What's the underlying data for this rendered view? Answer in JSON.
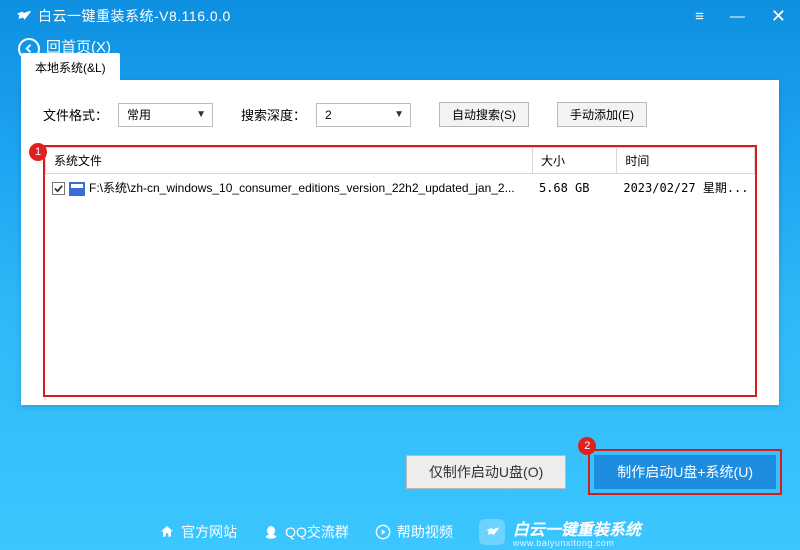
{
  "titlebar": {
    "app_title": "白云一键重装系统-V8.116.0.0"
  },
  "back": {
    "label": "回首页(X)"
  },
  "tab": {
    "local_system": "本地系统(&L)"
  },
  "filters": {
    "format_label": "文件格式：",
    "format_value": "常用",
    "depth_label": "搜索深度：",
    "depth_value": "2",
    "auto_search": "自动搜索(S)",
    "manual_add": "手动添加(E)"
  },
  "table": {
    "col_file": "系统文件",
    "col_size": "大小",
    "col_time": "时间",
    "rows": [
      {
        "checked": true,
        "path": "F:\\系统\\zh-cn_windows_10_consumer_editions_version_22h2_updated_jan_2...",
        "size": "5.68 GB",
        "time": "2023/02/27 星期..."
      }
    ]
  },
  "steps": {
    "one": "1",
    "two": "2"
  },
  "actions": {
    "make_usb_only": "仅制作启动U盘(O)",
    "make_usb_system": "制作启动U盘+系统(U)"
  },
  "footer": {
    "site": "官方网站",
    "qq": "QQ交流群",
    "help": "帮助视频",
    "brand": "白云一键重装系统",
    "brand_sub": "www.baiyunxitong.com"
  }
}
